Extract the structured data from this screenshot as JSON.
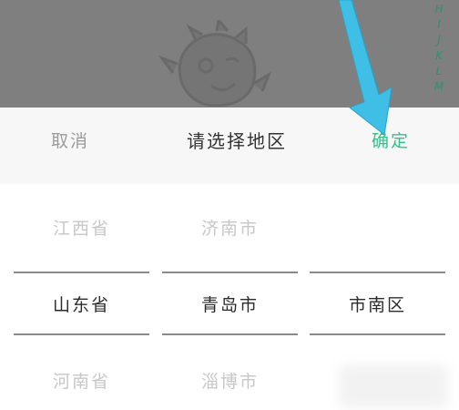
{
  "alpha_index": [
    "H",
    "I",
    "J",
    "K",
    "L",
    "M"
  ],
  "sheet": {
    "cancel_label": "取消",
    "title": "请选择地区",
    "confirm_label": "确定"
  },
  "picker": {
    "province": {
      "above": "江西省",
      "selected": "山东省",
      "below": "河南省"
    },
    "city": {
      "above": "济南市",
      "selected": "青岛市",
      "below": "淄博市"
    },
    "district": {
      "above": "",
      "selected": "市南区",
      "below": ""
    }
  },
  "colors": {
    "accent": "#35c08a",
    "backdrop": "#7f7f7f",
    "arrow": "#3fbfe6"
  }
}
